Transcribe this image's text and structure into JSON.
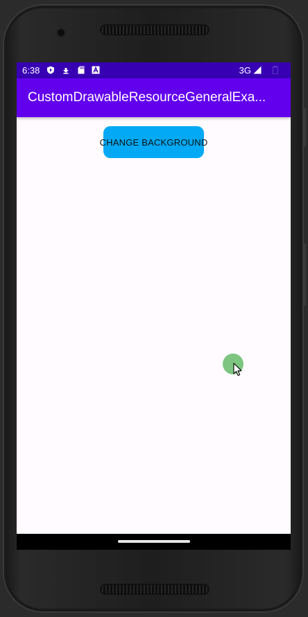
{
  "status_bar": {
    "time": "6:38",
    "network": "3G",
    "icons": [
      "shield-icon",
      "download-icon",
      "sd-card-icon",
      "font-a-icon",
      "signal-icon",
      "battery-icon"
    ],
    "background_color": "#3700b3"
  },
  "app_bar": {
    "title": "CustomDrawableResourceGeneralExa...",
    "background_color": "#6200ee"
  },
  "main": {
    "change_background_label": "CHANGE BACKGROUND",
    "button_color": "#03a9f4",
    "background_color": "#fffbfe"
  },
  "touch_indicator": {
    "color": "#66bb6a",
    "icon": "pointer-cursor-icon"
  }
}
